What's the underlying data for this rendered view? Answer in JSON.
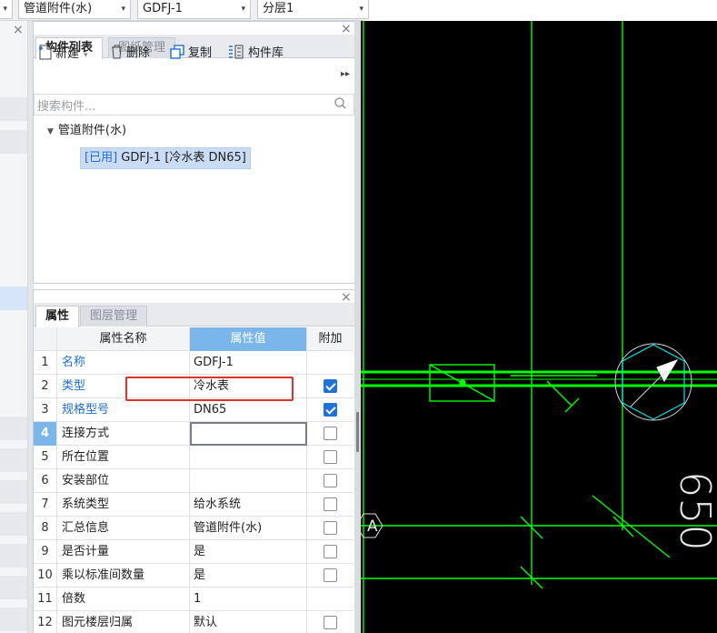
{
  "toolbar": {
    "type_combo": "管道附件(水)",
    "component_combo": "GDFJ-1",
    "layer_combo": "分层1"
  },
  "component_panel": {
    "tabs": [
      "构件列表",
      "图纸管理"
    ],
    "actions": {
      "new": "新建",
      "delete": "删除",
      "copy": "复制",
      "library": "构件库"
    },
    "search_placeholder": "搜索构件...",
    "tree_root": "管道附件(水)",
    "tree_leaf_status": "[已用]",
    "tree_leaf_text": "GDFJ-1 [冷水表 DN65]"
  },
  "property_panel": {
    "tabs": [
      "属性",
      "图层管理"
    ],
    "headers": {
      "name": "属性名称",
      "value": "属性值",
      "add": "附加"
    },
    "rows": [
      {
        "no": "1",
        "name": "名称",
        "value": "GDFJ-1",
        "checked": false,
        "has_check": false,
        "blue": true
      },
      {
        "no": "2",
        "name": "类型",
        "value": "冷水表",
        "checked": true,
        "has_check": true,
        "blue": true
      },
      {
        "no": "3",
        "name": "规格型号",
        "value": "DN65",
        "checked": true,
        "has_check": true,
        "blue": true
      },
      {
        "no": "4",
        "name": "连接方式",
        "value": "",
        "checked": false,
        "has_check": true,
        "blue": false
      },
      {
        "no": "5",
        "name": "所在位置",
        "value": "",
        "checked": false,
        "has_check": true,
        "blue": false
      },
      {
        "no": "6",
        "name": "安装部位",
        "value": "",
        "checked": false,
        "has_check": true,
        "blue": false
      },
      {
        "no": "7",
        "name": "系统类型",
        "value": "给水系统",
        "checked": false,
        "has_check": true,
        "blue": false
      },
      {
        "no": "8",
        "name": "汇总信息",
        "value": "管道附件(水)",
        "checked": false,
        "has_check": true,
        "blue": false
      },
      {
        "no": "9",
        "name": "是否计量",
        "value": "是",
        "checked": false,
        "has_check": true,
        "blue": false
      },
      {
        "no": "10",
        "name": "乘以标准间数量",
        "value": "是",
        "checked": false,
        "has_check": true,
        "blue": false
      },
      {
        "no": "11",
        "name": "倍数",
        "value": "1",
        "checked": false,
        "has_check": false,
        "blue": false
      },
      {
        "no": "12",
        "name": "图元楼层归属",
        "value": "默认",
        "checked": false,
        "has_check": true,
        "blue": false
      }
    ]
  },
  "cad": {
    "axis_label": "A",
    "dimension_text": "650",
    "colors": {
      "background": "#000000",
      "line": "#00ff00",
      "symbol": "#00ffff"
    }
  }
}
